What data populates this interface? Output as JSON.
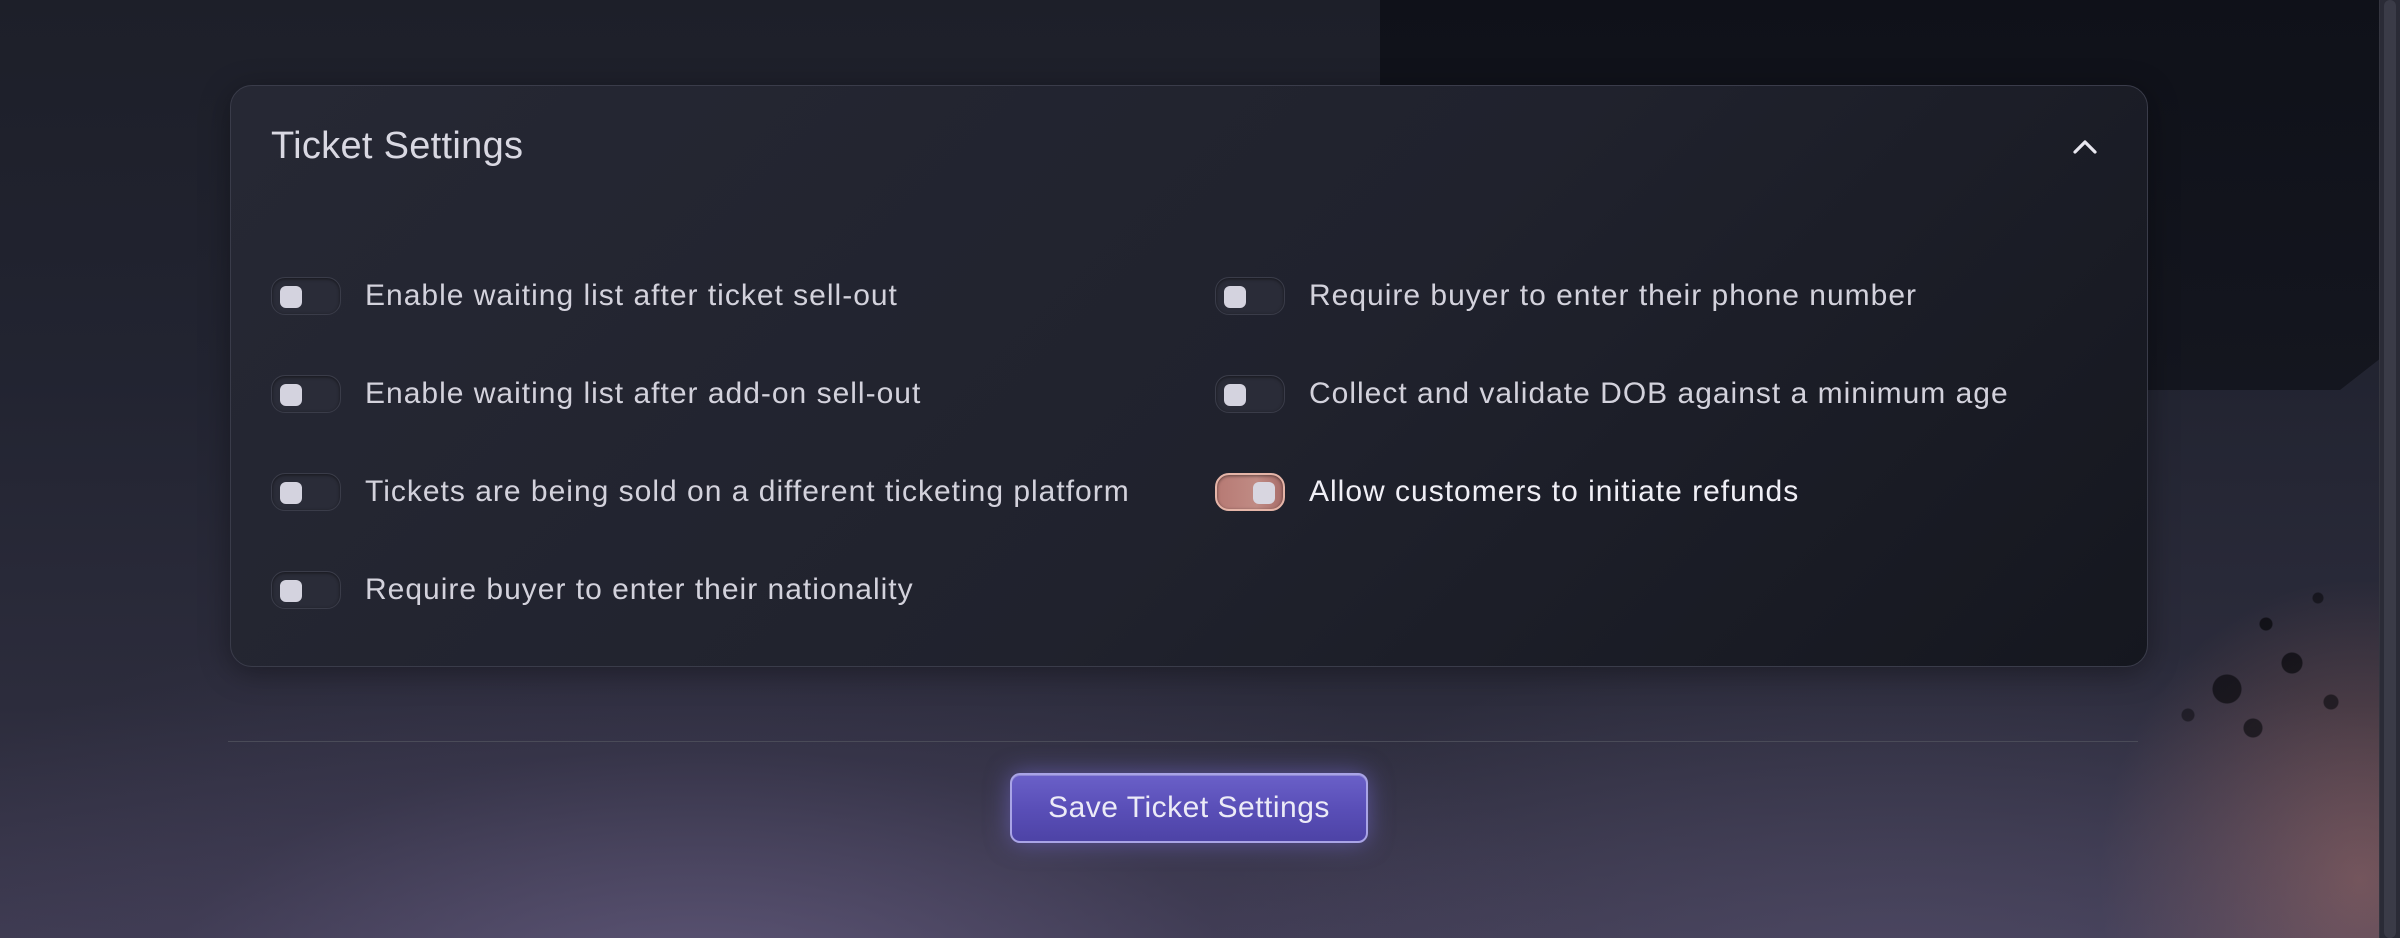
{
  "card": {
    "title": "Ticket Settings",
    "collapse_icon": "chevron-up-icon"
  },
  "options": {
    "left": [
      {
        "label": "Enable waiting list after ticket sell-out",
        "checked": false
      },
      {
        "label": "Enable waiting list after add-on sell-out",
        "checked": false
      },
      {
        "label": "Tickets are being sold on a different ticketing platform",
        "checked": false
      },
      {
        "label": "Require buyer to enter their nationality",
        "checked": false
      }
    ],
    "right": [
      {
        "label": "Require buyer to enter their phone number",
        "checked": false
      },
      {
        "label": "Collect and validate DOB against a minimum age",
        "checked": false
      },
      {
        "label": "Allow customers to initiate refunds",
        "checked": true
      }
    ]
  },
  "footer": {
    "save_label": "Save Ticket Settings"
  },
  "colors": {
    "accent": "#5a4fb8",
    "toggle_on": "#c08b84"
  }
}
